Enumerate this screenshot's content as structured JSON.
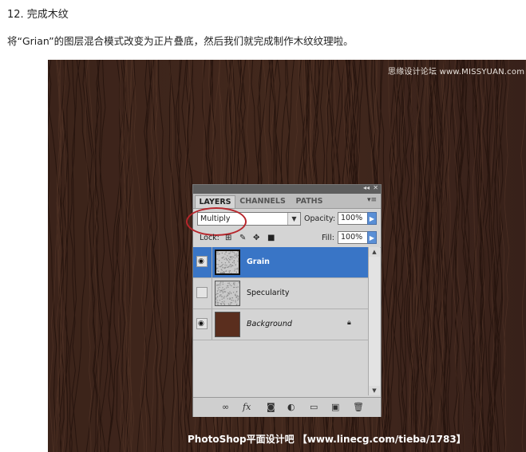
{
  "article": {
    "step_title": "12. 完成木纹",
    "step_text": "将“Grian”的图层混合模式改变为正片叠底，然后我们就完成制作木纹纹理啦。"
  },
  "image": {
    "watermark": "思缘设计论坛 www.MISSYUAN.com",
    "footer": "PhotoShop平面设计吧 【www.linecg.com/tieba/1783】"
  },
  "panel": {
    "tabs": [
      {
        "label": "LAYERS",
        "active": true
      },
      {
        "label": "CHANNELS",
        "active": false
      },
      {
        "label": "PATHS",
        "active": false
      }
    ],
    "blend_mode": "Multiply",
    "opacity_label": "Opacity:",
    "opacity_value": "100%",
    "lock_label": "Lock:",
    "fill_label": "Fill:",
    "fill_value": "100%",
    "layers": [
      {
        "name": "Grain",
        "visible": true,
        "selected": true,
        "italic": false,
        "locked": false
      },
      {
        "name": "Specularity",
        "visible": false,
        "selected": false,
        "italic": false,
        "locked": false
      },
      {
        "name": "Background",
        "visible": true,
        "selected": false,
        "italic": true,
        "locked": true
      }
    ],
    "icons": {
      "collapse": "double-chevron-left-icon",
      "close": "close-icon",
      "menu": "panel-menu-icon",
      "bottom": [
        "link-layers-icon",
        "fx-icon",
        "layer-mask-icon",
        "adjustment-layer-icon",
        "group-folder-icon",
        "new-layer-icon",
        "trash-icon"
      ]
    }
  },
  "colors": {
    "wood_base": "#3a2219",
    "selection": "#3975c6",
    "annotation": "#b7262c",
    "background_thumb": "#5a2e1e"
  }
}
